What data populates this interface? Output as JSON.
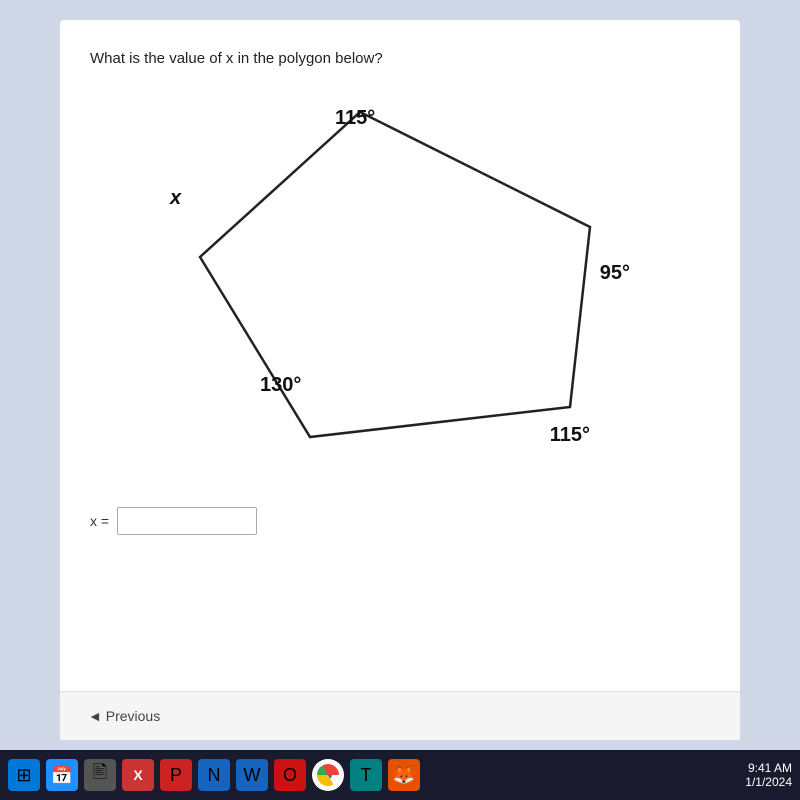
{
  "question": {
    "text": "What is the value of x in the polygon below?",
    "angles": {
      "top": "115°",
      "left": "x",
      "right": "95°",
      "bottom_right": "115°",
      "bottom_left": "130°"
    }
  },
  "answer_field": {
    "label": "x =",
    "placeholder": ""
  },
  "navigation": {
    "previous_label": "◄ Previous"
  },
  "taskbar": {
    "icons": []
  }
}
